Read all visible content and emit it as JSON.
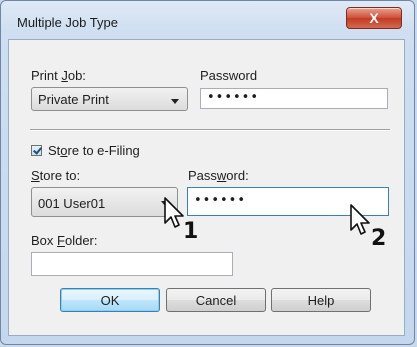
{
  "window": {
    "title": "Multiple Job Type",
    "close_glyph": "X"
  },
  "print_job": {
    "label_pre": "Print ",
    "label_mnemonic": "J",
    "label_post": "ob:",
    "value": "Private Print"
  },
  "password1": {
    "label": "Password",
    "value": "••••••"
  },
  "store_checkbox": {
    "label_pre": "St",
    "label_mnemonic": "o",
    "label_post": "re to e-Filing",
    "checked": true
  },
  "store_to": {
    "label_pre": "",
    "label_mnemonic": "S",
    "label_post": "tore to:",
    "value": "001 User01"
  },
  "password2": {
    "label_pre": "Pass",
    "label_mnemonic": "w",
    "label_post": "ord:",
    "value": "••••••"
  },
  "box_folder": {
    "label_pre": "Box ",
    "label_mnemonic": "F",
    "label_post": "older:",
    "value": ""
  },
  "buttons": {
    "ok": "OK",
    "cancel": "Cancel",
    "help": "Help"
  },
  "markers": {
    "one": "1",
    "two": "2"
  }
}
